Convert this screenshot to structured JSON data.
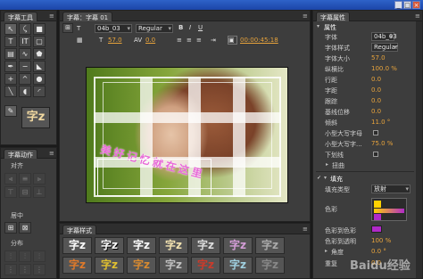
{
  "window": {
    "title": ""
  },
  "title_tools": {
    "tab": "字幕工具",
    "tools": [
      "select",
      "rotate",
      "type",
      "vertical-type",
      "area-type",
      "path-type",
      "pen",
      "delete-anchor",
      "add-anchor",
      "convert-anchor",
      "rectangle",
      "rounded-rect",
      "clipped-corner",
      "round-corner",
      "wedge",
      "arc",
      "ellipse",
      "line"
    ],
    "sample_text": "字z"
  },
  "title_actions": {
    "tab": "字幕动作",
    "align_label": "对齐",
    "center_label": "居中",
    "distribute_label": "分布"
  },
  "title_main": {
    "tab": "字幕：字幕 01",
    "font": "04b_03",
    "style": "Regular",
    "size": "57.0",
    "kerning": "0.0",
    "timecode": "00:00:45:18"
  },
  "title_styles": {
    "tab": "字幕样式",
    "sample": "字z"
  },
  "properties": {
    "tab": "字幕属性",
    "section_attributes": "属性",
    "font_label": "字体",
    "font_value": "04b_03",
    "style_label": "字体样式",
    "style_value": "Regular",
    "size_label": "字体大小",
    "size_value": "57.0",
    "aspect_label": "纵横比",
    "aspect_value": "100.0 %",
    "leading_label": "行距",
    "leading_value": "0.0",
    "kerning_label": "字距",
    "kerning_value": "0.0",
    "tracking_label": "跟踪",
    "tracking_value": "0.0",
    "baseline_label": "基线位移",
    "baseline_value": "0.0",
    "slant_label": "倾斜",
    "slant_value": "11.0 °",
    "smallcaps_label": "小型大写字母",
    "smallcaps_size_label": "小型大写字...",
    "smallcaps_size_value": "75.0 %",
    "underline_label": "下划线",
    "distort_label": "扭曲",
    "fill_label": "填充",
    "fill_type_label": "填充类型",
    "fill_type_value": "放射",
    "color_label": "色彩",
    "color_stop_label": "色彩到色彩",
    "color_opacity_label": "色彩到透明",
    "color_opacity_value": "100 %",
    "angle_label": "角度",
    "angle_value": "0.0 °",
    "repeat_label": "重复",
    "repeat_value": "0.0",
    "accent_color": "#e7a33c",
    "gradient_color": "#b02ac8",
    "stop_color": "#ffd200"
  },
  "canvas": {
    "title_text": "美好记忆就在这里"
  },
  "watermark": {
    "text": "Baidu经验"
  }
}
